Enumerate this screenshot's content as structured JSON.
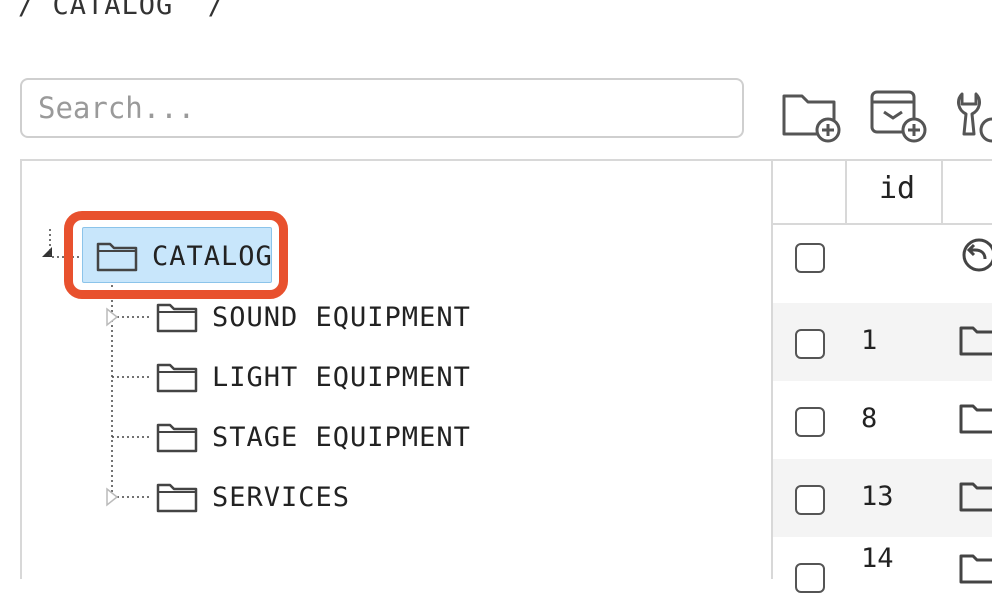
{
  "breadcrumb": {
    "text": "/ CATALOG  /"
  },
  "search": {
    "placeholder": "Search..."
  },
  "toolbar": {
    "icons": [
      "folder-add-icon",
      "save-add-icon",
      "settings-wrench-icon"
    ]
  },
  "tree": {
    "root": {
      "label": "CATALOG"
    },
    "children": [
      {
        "label": "SOUND EQUIPMENT",
        "expandable": true
      },
      {
        "label": "LIGHT EQUIPMENT",
        "expandable": false
      },
      {
        "label": "STAGE EQUIPMENT",
        "expandable": false
      },
      {
        "label": "SERVICES",
        "expandable": true
      }
    ]
  },
  "grid": {
    "header": {
      "id_label": "id"
    },
    "rows": [
      {
        "id": "",
        "icon": "back-arrow-icon"
      },
      {
        "id": "1",
        "icon": "folder-icon"
      },
      {
        "id": "8",
        "icon": "folder-icon"
      },
      {
        "id": "13",
        "icon": "folder-icon"
      },
      {
        "id": "14",
        "icon": "folder-icon"
      }
    ]
  },
  "colors": {
    "highlight": "#e8512e",
    "selected_bg": "#c8e6fb"
  }
}
